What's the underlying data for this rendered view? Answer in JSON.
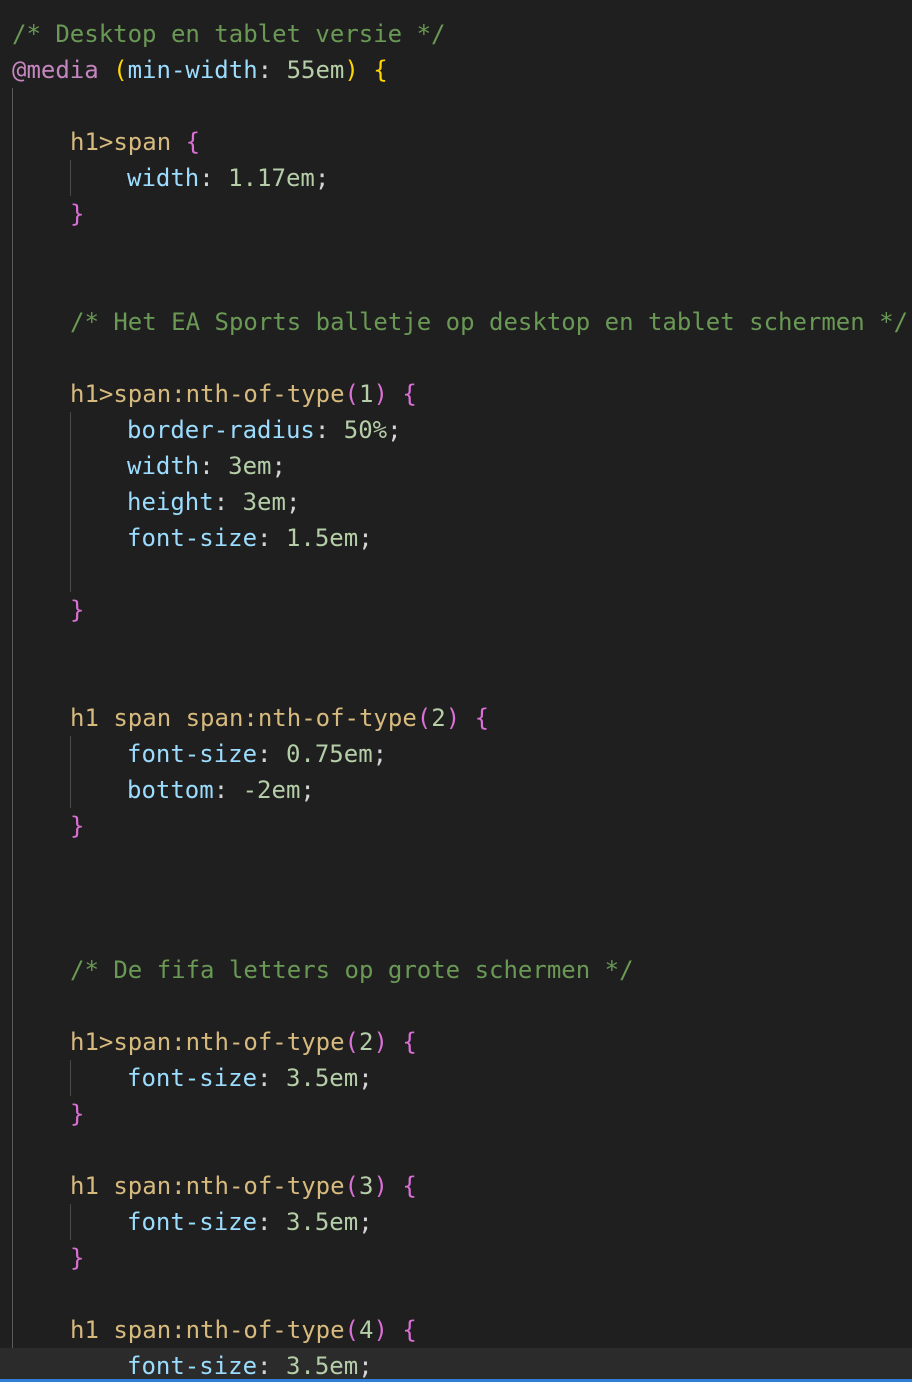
{
  "code": {
    "l01": "/* Desktop en tablet versie */",
    "l02_at": "@media",
    "l02_open": "(",
    "l02_prop": "min-width",
    "l02_colon": ": ",
    "l02_val": "55em",
    "l02_close": ")",
    "l02_brace": "{",
    "l04_sel": "h1>span",
    "l04_brace": "{",
    "l05_prop": "width",
    "l05_val": "1.17em",
    "l06_brace": "}",
    "l09": "/* Het EA Sports balletje op desktop en tablet schermen */",
    "l11_sel": "h1>span:nth-of-type",
    "l11_arg": "1",
    "l12_prop": "border-radius",
    "l12_val": "50%",
    "l13_prop": "width",
    "l13_val": "3em",
    "l14_prop": "height",
    "l14_val": "3em",
    "l15_prop": "font-size",
    "l15_val": "1.5em",
    "l20_sel": "h1 span span:nth-of-type",
    "l20_arg": "2",
    "l21_prop": "font-size",
    "l21_val": "0.75em",
    "l22_prop": "bottom",
    "l22_val": "-2em",
    "l27": "/* De fifa letters op grote schermen */",
    "l29_sel": "h1>span:nth-of-type",
    "l29_arg": "2",
    "l30_prop": "font-size",
    "l30_val": "3.5em",
    "l33_sel": "h1 span:nth-of-type",
    "l33_arg": "3",
    "l34_prop": "font-size",
    "l34_val": "3.5em",
    "l37_sel": "h1 span:nth-of-type",
    "l37_arg": "4",
    "l38_prop": "font-size",
    "l38_val": "3.5em",
    "brace_open": "{",
    "brace_close": "}",
    "colon": ": ",
    "semicolon": ";"
  }
}
